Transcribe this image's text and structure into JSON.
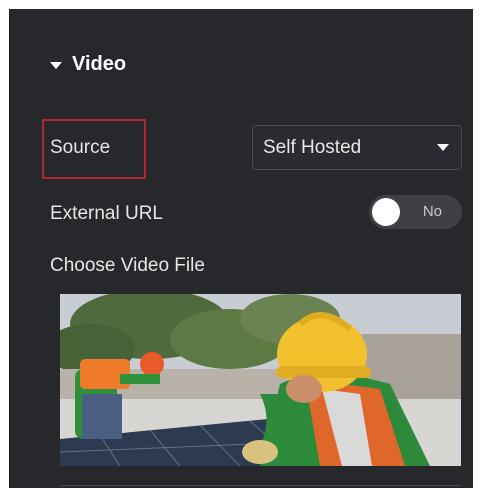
{
  "section": {
    "title": "Video"
  },
  "source": {
    "label": "Source",
    "selected": "Self Hosted"
  },
  "external_url": {
    "label": "External URL",
    "toggle_text": "No"
  },
  "video_file": {
    "label": "Choose Video File",
    "preview_icon": "video-thumbnail-workers-solar-panels"
  },
  "colors": {
    "panel_bg": "#27282c",
    "highlight": "#b3262c",
    "text": "#e6e6e6"
  }
}
